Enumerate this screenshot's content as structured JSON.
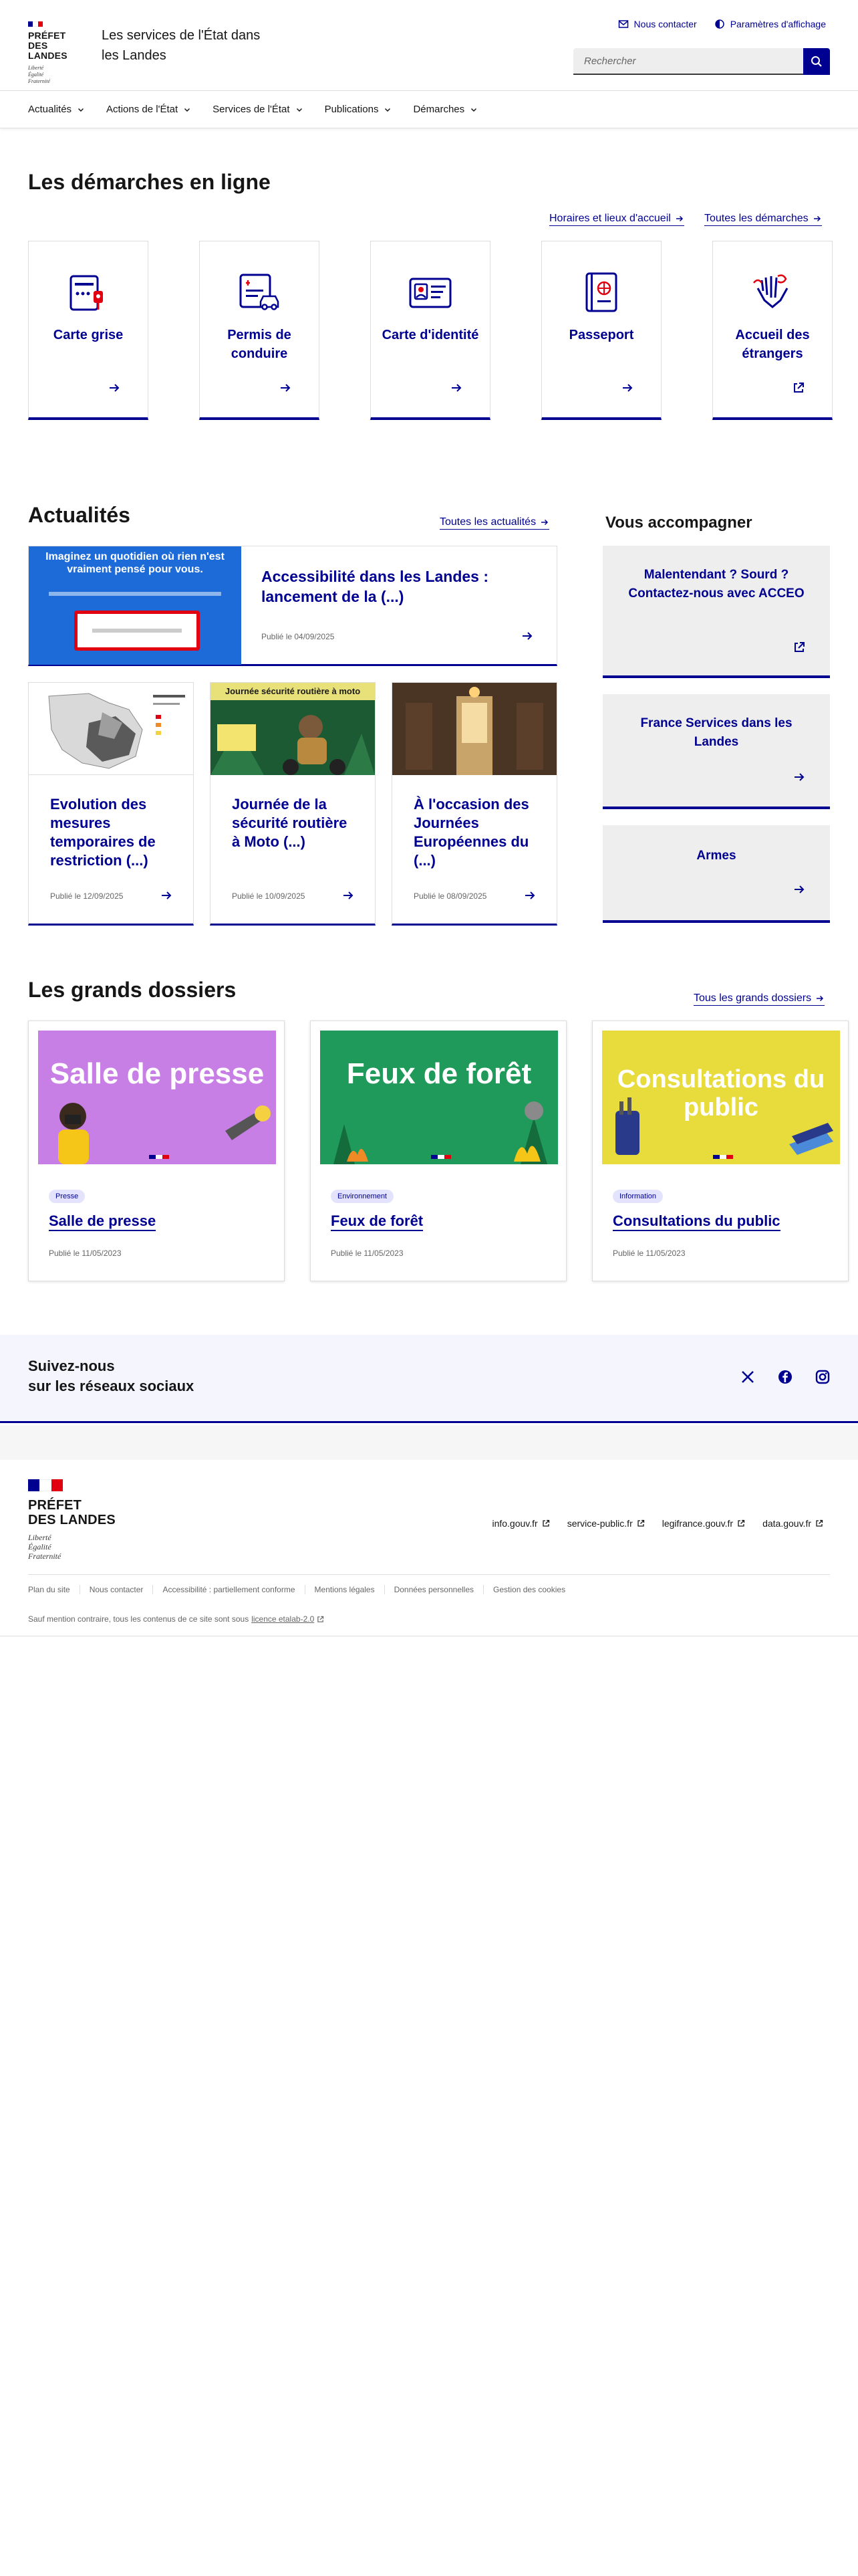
{
  "colors": {
    "primary": "#000091",
    "flag_blue": "#000091",
    "flag_white": "#ffffff",
    "flag_red": "#e1000f",
    "text": "#161616",
    "muted": "#666666"
  },
  "header": {
    "logo_title": [
      "PRÉFET",
      "DES LANDES"
    ],
    "logo_motto": [
      "Liberté",
      "Égalité",
      "Fraternité"
    ],
    "service_title": "Les services de l'État dans les Landes",
    "tools": [
      {
        "label": "Nous contacter",
        "icon": "mail-icon"
      },
      {
        "label": "Paramètres d'affichage",
        "icon": "theme-icon"
      }
    ],
    "search_placeholder": "Rechercher"
  },
  "nav": {
    "items": [
      "Actualités",
      "Actions de l'État",
      "Services de l'État",
      "Publications",
      "Démarches"
    ]
  },
  "demarches": {
    "title": "Les démarches en ligne",
    "links": [
      "Horaires et lieux d'accueil",
      "Toutes les démarches"
    ],
    "cards": [
      {
        "label": "Carte grise",
        "icon": "car-registration-icon",
        "external": false
      },
      {
        "label": "Permis de conduire",
        "icon": "driving-licence-icon",
        "external": false
      },
      {
        "label": "Carte d'identité",
        "icon": "id-card-icon",
        "external": false
      },
      {
        "label": "Passeport",
        "icon": "passport-icon",
        "external": false
      },
      {
        "label": "Accueil des étrangers",
        "icon": "welcome-hands-icon",
        "external": true
      }
    ]
  },
  "actualites": {
    "title": "Actualités",
    "all_link": "Toutes les actualités",
    "featured": {
      "title": "Accessibilité dans les Landes : lancement de la (...)",
      "meta": "Publié le 04/09/2025",
      "image_text": "Imaginez un quotidien où rien n'est vraiment pensé pour vous."
    },
    "items": [
      {
        "title": "Evolution des mesures temporaires de restriction (...)",
        "meta": "Publié le 12/09/2025"
      },
      {
        "title": "Journée de la sécurité routière à Moto (...)",
        "meta": "Publié le 10/09/2025",
        "image_text": "Journée sécurité routière à moto"
      },
      {
        "title": "À l'occasion des Journées Européennes du (...)",
        "meta": "Publié le 08/09/2025"
      }
    ]
  },
  "accompagner": {
    "title": "Vous accompagner",
    "cards": [
      {
        "label": "Malentendant ? Sourd ? Contactez-nous avec ACCEO",
        "external": true
      },
      {
        "label": "France Services dans les Landes",
        "external": false
      },
      {
        "label": "Armes",
        "external": false
      }
    ]
  },
  "dossiers": {
    "title": "Les grands dossiers",
    "all_link": "Tous les grands dossiers",
    "cards": [
      {
        "image_text": "Salle de presse",
        "tag": "Presse",
        "title": "Salle de presse",
        "meta": "Publié le 11/05/2023",
        "bg": "#c77fe6"
      },
      {
        "image_text": "Feux de forêt",
        "tag": "Environnement",
        "title": "Feux de forêt",
        "meta": "Publié le 11/05/2023",
        "bg": "#1f9a5a"
      },
      {
        "image_text": "Consultations du public",
        "tag": "Information",
        "title": "Consultations du public",
        "meta": "Publié le 11/05/2023",
        "bg": "#e8dc3c"
      }
    ]
  },
  "social": {
    "title": [
      "Suivez-nous",
      "sur les réseaux sociaux"
    ],
    "networks": [
      "x-icon",
      "facebook-icon",
      "instagram-icon"
    ]
  },
  "footer": {
    "links": [
      "info.gouv.fr",
      "service-public.fr",
      "legifrance.gouv.fr",
      "data.gouv.fr"
    ],
    "bottom_links": [
      "Plan du site",
      "Nous contacter",
      "Accessibilité : partiellement conforme",
      "Mentions légales",
      "Données personnelles",
      "Gestion des cookies"
    ],
    "licence_prefix": "Sauf mention contraire, tous les contenus de ce site sont sous",
    "licence_link": "licence etalab-2.0"
  }
}
